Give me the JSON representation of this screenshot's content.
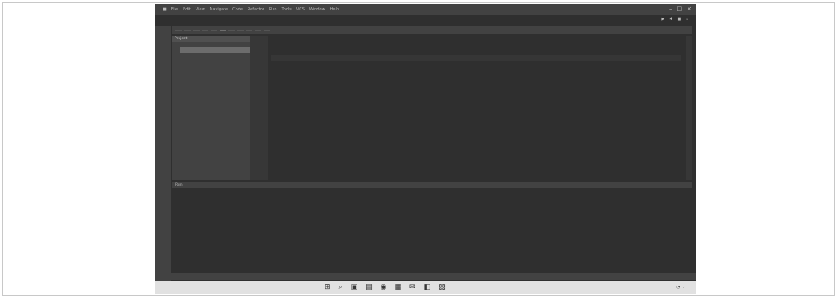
{
  "menu": {
    "items": [
      "File",
      "Edit",
      "View",
      "Navigate",
      "Code",
      "Refactor",
      "Run",
      "Tools",
      "VCS",
      "Window",
      "Help"
    ],
    "window_title": ""
  },
  "toolbar": {
    "run_config": "",
    "project_label": ""
  },
  "tabs": [
    "",
    "",
    "",
    "",
    "",
    "",
    "",
    "",
    "",
    "",
    ""
  ],
  "active_tab_index": 5,
  "project": {
    "title": "Project",
    "items": [
      "",
      "",
      "",
      "",
      "",
      "",
      "",
      "",
      "",
      "",
      "",
      "",
      "",
      "",
      "",
      "",
      "",
      "",
      "",
      "",
      "",
      "",
      "",
      ""
    ],
    "selected_index": 1
  },
  "editor": {
    "lines": [
      "",
      "",
      "",
      "",
      "",
      "",
      "",
      ""
    ]
  },
  "run": {
    "tabs": [
      "Run",
      "",
      "",
      ""
    ],
    "active_tab_index": 3
  },
  "console": {
    "lines": [
      "",
      "",
      "",
      "",
      "",
      "",
      "",
      "",
      ""
    ]
  },
  "statusbar": {
    "items": [
      "",
      "",
      "",
      "",
      "",
      "",
      "",
      "",
      ""
    ],
    "right": ""
  },
  "taskbar": {
    "weather": "",
    "time": "",
    "date": ""
  }
}
